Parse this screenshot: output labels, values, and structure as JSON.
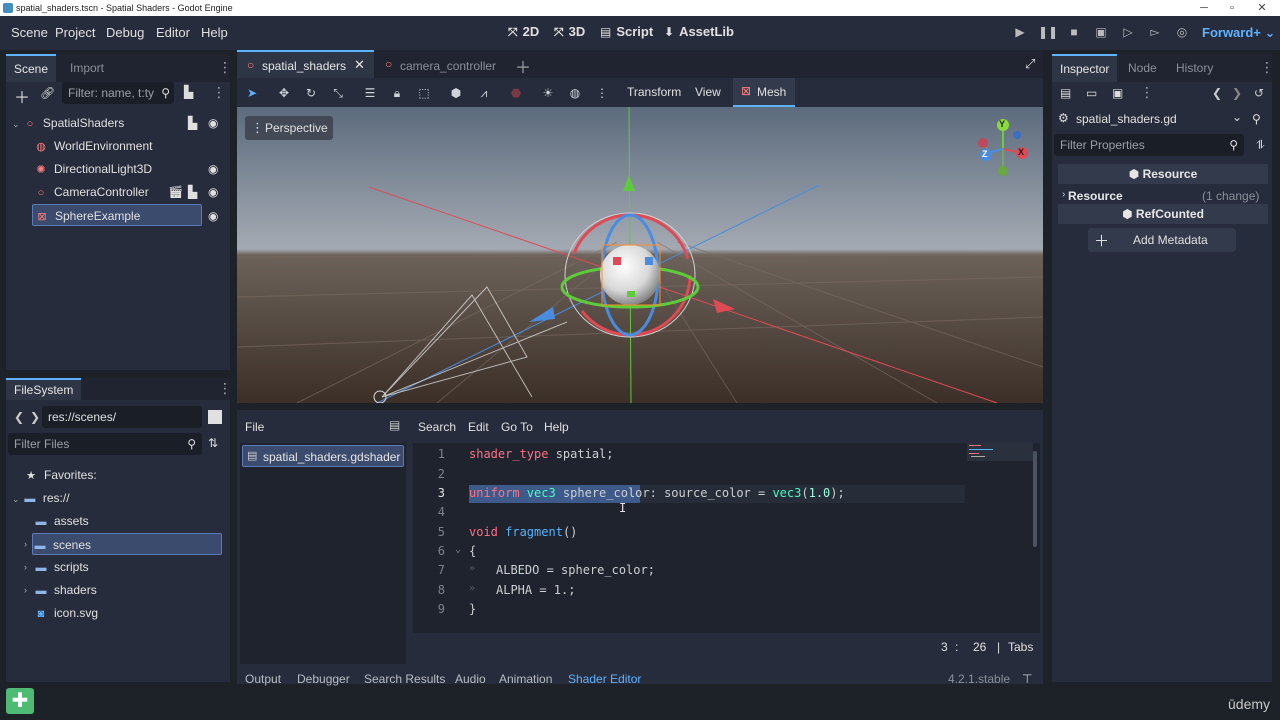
{
  "window": {
    "title": "spatial_shaders.tscn - Spatial Shaders - Godot Engine"
  },
  "menu": {
    "items": [
      "Scene",
      "Project",
      "Debug",
      "Editor",
      "Help"
    ]
  },
  "main_buttons": {
    "b2d": "2D",
    "b3d": "3D",
    "script": "Script",
    "assetlib": "AssetLib"
  },
  "renderer": "Forward+",
  "scene_dock": {
    "tabs": [
      "Scene",
      "Import"
    ],
    "filter_placeholder": "Filter: name, t:ty",
    "nodes": [
      "SpatialShaders",
      "WorldEnvironment",
      "DirectionalLight3D",
      "CameraController",
      "SphereExample"
    ]
  },
  "filesystem": {
    "tab": "FileSystem",
    "path": "res://scenes/",
    "filter_placeholder": "Filter Files",
    "favorites": "Favorites:",
    "root": "res://",
    "items": [
      "assets",
      "scenes",
      "scripts",
      "shaders",
      "icon.svg"
    ]
  },
  "editor_tabs": [
    "spatial_shaders",
    "camera_controller"
  ],
  "viewport": {
    "toolbar": [
      "Transform",
      "View",
      "Mesh"
    ],
    "perspective_label": "Perspective",
    "gizmo": {
      "x": "X",
      "y": "Y",
      "z": "Z"
    }
  },
  "shader_editor": {
    "menus": [
      "File",
      "Search",
      "Edit",
      "Go To",
      "Help"
    ],
    "file": "spatial_shaders.gdshader",
    "line_numbers": [
      "1",
      "2",
      "3",
      "4",
      "5",
      "6",
      "7",
      "8",
      "9"
    ],
    "code": {
      "l1a": "shader_type",
      "l1b": " spatial;",
      "l3a": "uniform",
      "l3b": " vec3",
      "l3c": " sphere_color",
      "l3d": ": source_color = ",
      "l3e": "vec3",
      "l3f": "(",
      "l3g": "1.0",
      "l3h": ");",
      "l5a": "void",
      "l5b": " fragment",
      "l5c": "()",
      "l6": "{",
      "l7": "ALBEDO = sphere_color;",
      "l8": "ALPHA = 1.;",
      "l9": "}"
    },
    "status": {
      "line": "3",
      "sep": ":",
      "col": "26",
      "indent": "Tabs"
    }
  },
  "bottom_tabs": [
    "Output",
    "Debugger",
    "Search Results",
    "Audio",
    "Animation",
    "Shader Editor"
  ],
  "version": "4.2.1.stable",
  "inspector": {
    "tabs": [
      "Inspector",
      "Node",
      "History"
    ],
    "resource_file": "spatial_shaders.gd",
    "filter_placeholder": "Filter Properties",
    "section_resource": "Resource",
    "row_resource": "Resource",
    "row_resource_change": "(1 change)",
    "section_refcounted": "RefCounted",
    "add_metadata": "Add Metadata"
  },
  "watermark": "ūdemy",
  "colors": {
    "accent": "#5fb2ff",
    "panel": "#262c3b",
    "selection": "#3b4b6d"
  }
}
